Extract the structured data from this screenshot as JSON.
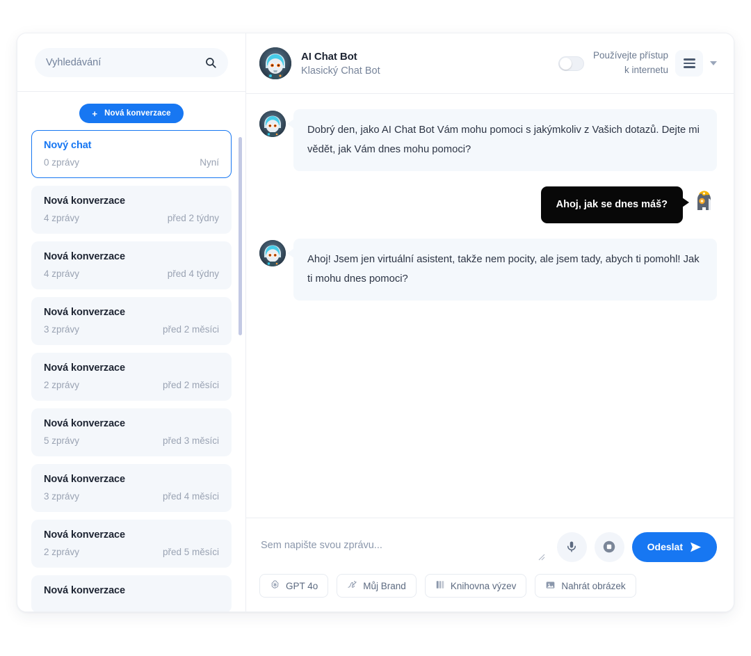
{
  "sidebar": {
    "search": {
      "placeholder": "Vyhledávání",
      "value": "",
      "icon": "search-icon"
    },
    "new_conversation_button": {
      "label": "Nová konverzace",
      "plus": "+"
    },
    "conversations": [
      {
        "title": "Nový chat",
        "messages": "0 zprávy",
        "time": "Nyní",
        "active": true
      },
      {
        "title": "Nová konverzace",
        "messages": "4 zprávy",
        "time": "před 2 týdny",
        "active": false
      },
      {
        "title": "Nová konverzace",
        "messages": "4 zprávy",
        "time": "před 4 týdny",
        "active": false
      },
      {
        "title": "Nová konverzace",
        "messages": "3 zprávy",
        "time": "před 2 měsíci",
        "active": false
      },
      {
        "title": "Nová konverzace",
        "messages": "2 zprávy",
        "time": "před 2 měsíci",
        "active": false
      },
      {
        "title": "Nová konverzace",
        "messages": "5 zprávy",
        "time": "před 3 měsíci",
        "active": false
      },
      {
        "title": "Nová konverzace",
        "messages": "3 zprávy",
        "time": "před 4 měsíci",
        "active": false
      },
      {
        "title": "Nová konverzace",
        "messages": "2 zprávy",
        "time": "před 5 měsíci",
        "active": false
      },
      {
        "title": "Nová konverzace",
        "messages": "",
        "time": "",
        "active": false
      }
    ]
  },
  "header": {
    "avatar": "bot-avatar",
    "title": "AI Chat Bot",
    "subtitle": "Klasický Chat Bot",
    "internet_toggle": {
      "label": "Používejte přístup k internetu",
      "state": "off"
    },
    "menu_button": "hamburger-menu",
    "caret": "chevron-down-icon"
  },
  "chat": {
    "messages": [
      {
        "role": "bot",
        "text": "Dobrý den, jako AI Chat Bot Vám mohu pomoci s jakýmkoliv z Vašich dotazů. Dejte mi vědět, jak Vám dnes mohu pomoci?"
      },
      {
        "role": "user",
        "text": "Ahoj, jak se dnes máš?"
      },
      {
        "role": "bot",
        "text": "Ahoj! Jsem jen virtuální asistent, takže nem pocity, ale jsem tady, abych ti pomohl! Jak ti mohu dnes pomoci?"
      }
    ]
  },
  "composer": {
    "placeholder": "Sem napište svou zprávu...",
    "value": "",
    "mic_button": "microphone-icon",
    "stop_button": "stop-record-icon",
    "send_button": "Odeslat",
    "tools": [
      {
        "label": "GPT 4o",
        "icon": "openai-logo-icon"
      },
      {
        "label": "Můj Brand",
        "icon": "signature-icon"
      },
      {
        "label": "Knihovna výzev",
        "icon": "book-icon"
      },
      {
        "label": "Nahrát obrázek",
        "icon": "image-icon"
      }
    ]
  },
  "colors": {
    "accent": "#1777f2",
    "bubble_bot_bg": "#f4f8fc",
    "bubble_user_bg": "#080808",
    "panel_bg": "#f4f7fb"
  }
}
